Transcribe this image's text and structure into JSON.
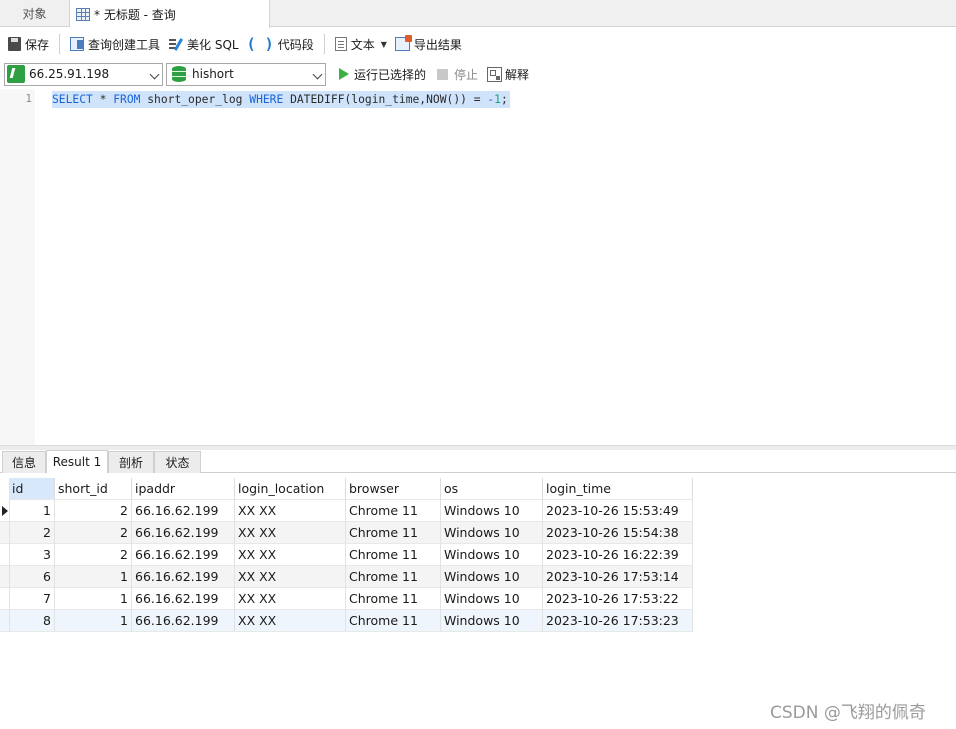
{
  "tabs": {
    "objects_label": "对象",
    "query_label": "* 无标题 - 查询"
  },
  "toolbar": {
    "save_label": "保存",
    "query_builder_label": "查询创建工具",
    "beautify_label": "美化 SQL",
    "code_snippet_label": "代码段",
    "text_label": "文本",
    "export_label": "导出结果"
  },
  "connection": {
    "host": "66.25.91.198",
    "database": "hishort",
    "run_selected_label": "运行已选择的",
    "stop_label": "停止",
    "explain_label": "解释"
  },
  "editor": {
    "line_number": "1",
    "tokens": {
      "select": "SELECT",
      "star": " * ",
      "from": "FROM",
      "table": " short_oper_log ",
      "where": "WHERE",
      "expr": " DATEDIFF(login_time,NOW()) = ",
      "minus": "-",
      "one": "1",
      "semicolon": ";"
    }
  },
  "result_tabs": {
    "info": "信息",
    "result1": "Result 1",
    "profile": "剖析",
    "status": "状态"
  },
  "grid": {
    "headers": [
      "id",
      "short_id",
      "ipaddr",
      "login_location",
      "browser",
      "os",
      "login_time"
    ],
    "rows": [
      [
        "1",
        "2",
        "66.16.62.199",
        "XX XX",
        "Chrome 11",
        "Windows 10",
        "2023-10-26 15:53:49"
      ],
      [
        "2",
        "2",
        "66.16.62.199",
        "XX XX",
        "Chrome 11",
        "Windows 10",
        "2023-10-26 15:54:38"
      ],
      [
        "3",
        "2",
        "66.16.62.199",
        "XX XX",
        "Chrome 11",
        "Windows 10",
        "2023-10-26 16:22:39"
      ],
      [
        "6",
        "1",
        "66.16.62.199",
        "XX XX",
        "Chrome 11",
        "Windows 10",
        "2023-10-26 17:53:14"
      ],
      [
        "7",
        "1",
        "66.16.62.199",
        "XX XX",
        "Chrome 11",
        "Windows 10",
        "2023-10-26 17:53:22"
      ],
      [
        "8",
        "1",
        "66.16.62.199",
        "XX XX",
        "Chrome 11",
        "Windows 10",
        "2023-10-26 17:53:23"
      ]
    ]
  },
  "watermark": "CSDN @飞翔的佩奇",
  "colors": {
    "keyword": "#1b63d6",
    "number": "#16a085",
    "selection": "#cfe3fb",
    "run_green": "#3cb043"
  }
}
